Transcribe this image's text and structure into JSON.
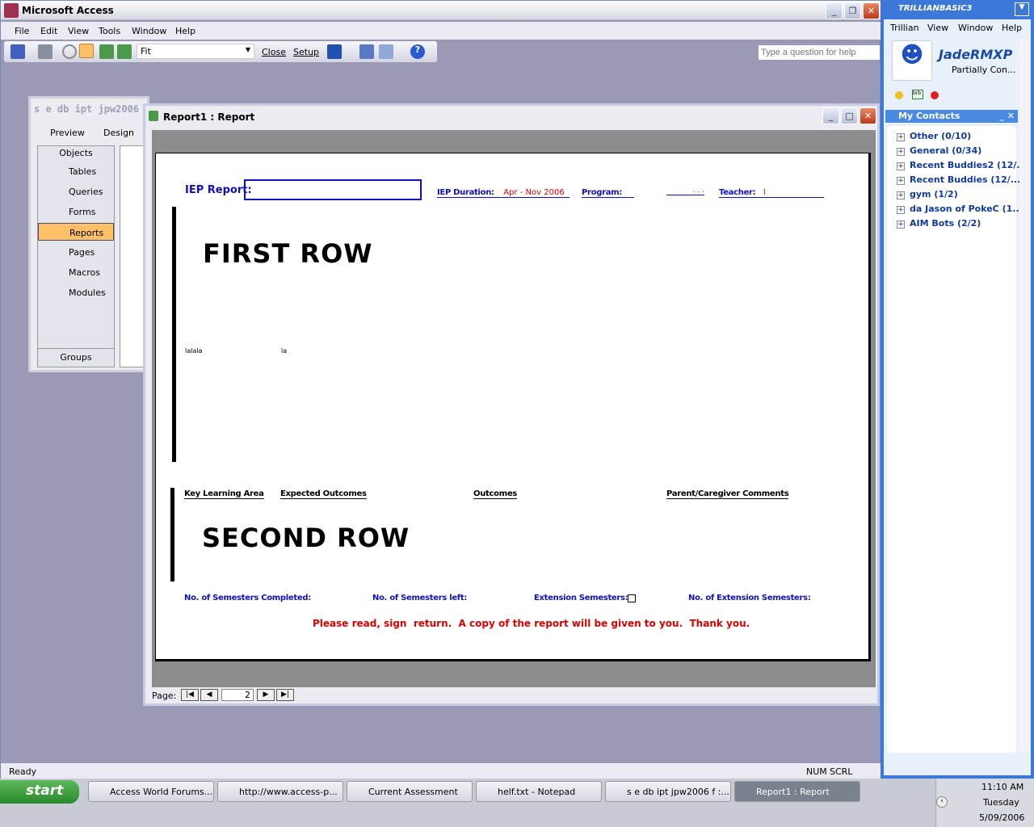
{
  "app": {
    "title": "Microsoft Access",
    "help_placeholder": "Type a question for help",
    "menu": [
      "File",
      "Edit",
      "View",
      "Tools",
      "Window",
      "Help"
    ],
    "toolbar": {
      "zoom_value": "Fit",
      "close": "Close",
      "setup": "Setup"
    },
    "status": {
      "text": "Ready",
      "num": "NUM",
      "scrl": "SCRL"
    }
  },
  "dbwindow": {
    "title": "s e db ipt jpw2006",
    "preview": "Preview",
    "design": "Design",
    "objects_header": "Objects",
    "groups": "Groups",
    "objects": [
      "Tables",
      "Queries",
      "Forms",
      "Reports",
      "Pages",
      "Macros",
      "Modules"
    ],
    "selected": "Reports"
  },
  "report": {
    "title": "Report1 : Report",
    "iep_report_label": "IEP Report:",
    "iep_duration_label": "IEP Duration:",
    "iep_duration_value": "Apr - Nov 2006",
    "program_label": "Program:",
    "program_value": ". . .",
    "teacher_label": "Teacher:",
    "teacher_value": "l",
    "first_row": "FIRST ROW",
    "lalala": "lalala",
    "la": "la",
    "columns": [
      "Key Learning Area",
      "Expected Outcomes",
      "Outcomes",
      "Parent/Caregiver Comments"
    ],
    "second_row": "SECOND ROW",
    "sem_completed": "No. of Semesters Completed:",
    "sem_left": "No. of Semesters left:",
    "ext_sem": "Extension Semesters:",
    "ext_sem_no": "No. of Extension Semesters:",
    "footer_note": "Please read, sign  return.  A copy of the report will be given to you.  Thank you.",
    "page_label": "Page:",
    "page_number": "2"
  },
  "trillian": {
    "brand": "TRILLIANBASIC3",
    "menu": [
      "Trillian",
      "View",
      "Window",
      "Help"
    ],
    "user": "JadeRMXP",
    "status": "Partially Con...",
    "brb": "brb",
    "contacts_title": "My Contacts",
    "groups": [
      "Other (0/10)",
      "General (0/34)",
      "Recent Buddies2 (12/...",
      "Recent Buddies (12/...",
      "gym (1/2)",
      "da Jason of PokeC (1...",
      "AIM Bots (2/2)"
    ]
  },
  "taskbar": {
    "start": "start",
    "tasks": [
      "Access World Forums...",
      "http://www.access-p...",
      "Current Assessment",
      "helf.txt - Notepad",
      "s e db ipt jpw2006 f :...",
      "Report1 : Report"
    ],
    "time": "11:10 AM",
    "day": "Tuesday",
    "date": "5/09/2006"
  }
}
